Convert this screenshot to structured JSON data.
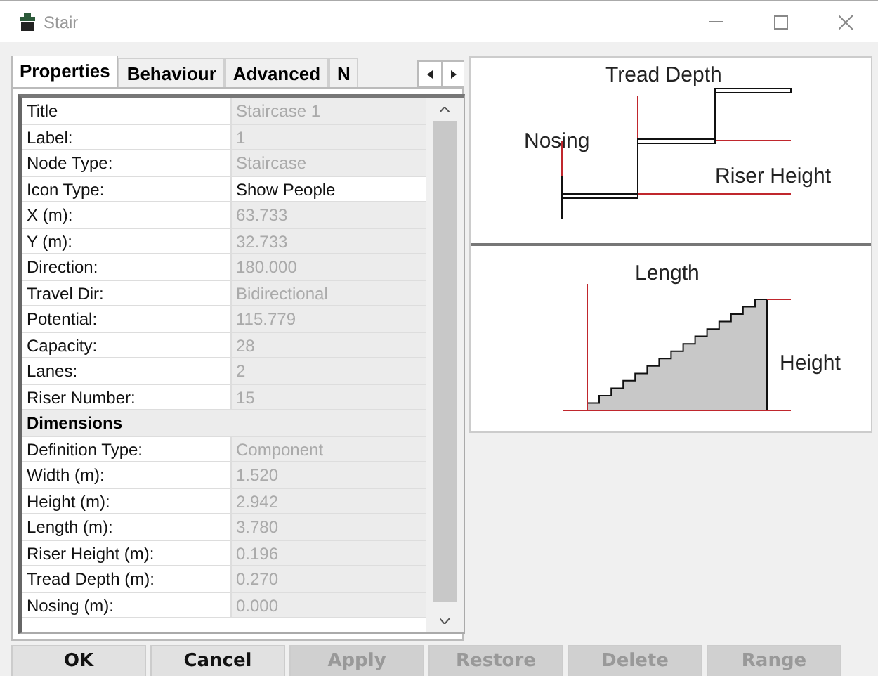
{
  "window": {
    "title": "Stair"
  },
  "tabs": [
    {
      "label": "Properties",
      "selected": true
    },
    {
      "label": "Behaviour",
      "selected": false
    },
    {
      "label": "Advanced",
      "selected": false
    },
    {
      "label": "N",
      "selected": false
    }
  ],
  "properties": [
    {
      "kind": "row",
      "label": "Title",
      "value": "Staircase 1",
      "editable": false
    },
    {
      "kind": "row",
      "label": "Label:",
      "value": "1",
      "editable": false
    },
    {
      "kind": "row",
      "label": "Node Type:",
      "value": "Staircase",
      "editable": false
    },
    {
      "kind": "row",
      "label": "Icon Type:",
      "value": "Show People",
      "editable": true
    },
    {
      "kind": "row",
      "label": "X (m):",
      "value": "63.733",
      "editable": false
    },
    {
      "kind": "row",
      "label": "Y (m):",
      "value": "32.733",
      "editable": false
    },
    {
      "kind": "row",
      "label": "Direction:",
      "value": "180.000",
      "editable": false
    },
    {
      "kind": "row",
      "label": "Travel Dir:",
      "value": "Bidirectional",
      "editable": false
    },
    {
      "kind": "row",
      "label": "Potential:",
      "value": "115.779",
      "editable": false
    },
    {
      "kind": "row",
      "label": "Capacity:",
      "value": "28",
      "editable": false
    },
    {
      "kind": "row",
      "label": "Lanes:",
      "value": "2",
      "editable": false
    },
    {
      "kind": "row",
      "label": "Riser Number:",
      "value": "15",
      "editable": false
    },
    {
      "kind": "section",
      "label": "Dimensions"
    },
    {
      "kind": "row",
      "label": "Definition Type:",
      "value": "Component",
      "editable": false
    },
    {
      "kind": "row",
      "label": "Width (m):",
      "value": "1.520",
      "editable": false
    },
    {
      "kind": "row",
      "label": "Height (m):",
      "value": "2.942",
      "editable": false
    },
    {
      "kind": "row",
      "label": "Length (m):",
      "value": "3.780",
      "editable": false
    },
    {
      "kind": "row",
      "label": "Riser Height (m):",
      "value": "0.196",
      "editable": false
    },
    {
      "kind": "row",
      "label": "Tread Depth (m):",
      "value": "0.270",
      "editable": false
    },
    {
      "kind": "row",
      "label": "Nosing (m):",
      "value": "0.000",
      "editable": false
    }
  ],
  "diagram": {
    "tread_depth": "Tread Depth",
    "nosing": "Nosing",
    "riser_height": "Riser Height",
    "length": "Length",
    "height": "Height"
  },
  "buttons": [
    {
      "label": "OK",
      "disabled": false
    },
    {
      "label": "Cancel",
      "disabled": false
    },
    {
      "label": "Apply",
      "disabled": true
    },
    {
      "label": "Restore",
      "disabled": true
    },
    {
      "label": "Delete",
      "disabled": true
    },
    {
      "label": "Range",
      "disabled": true
    }
  ]
}
